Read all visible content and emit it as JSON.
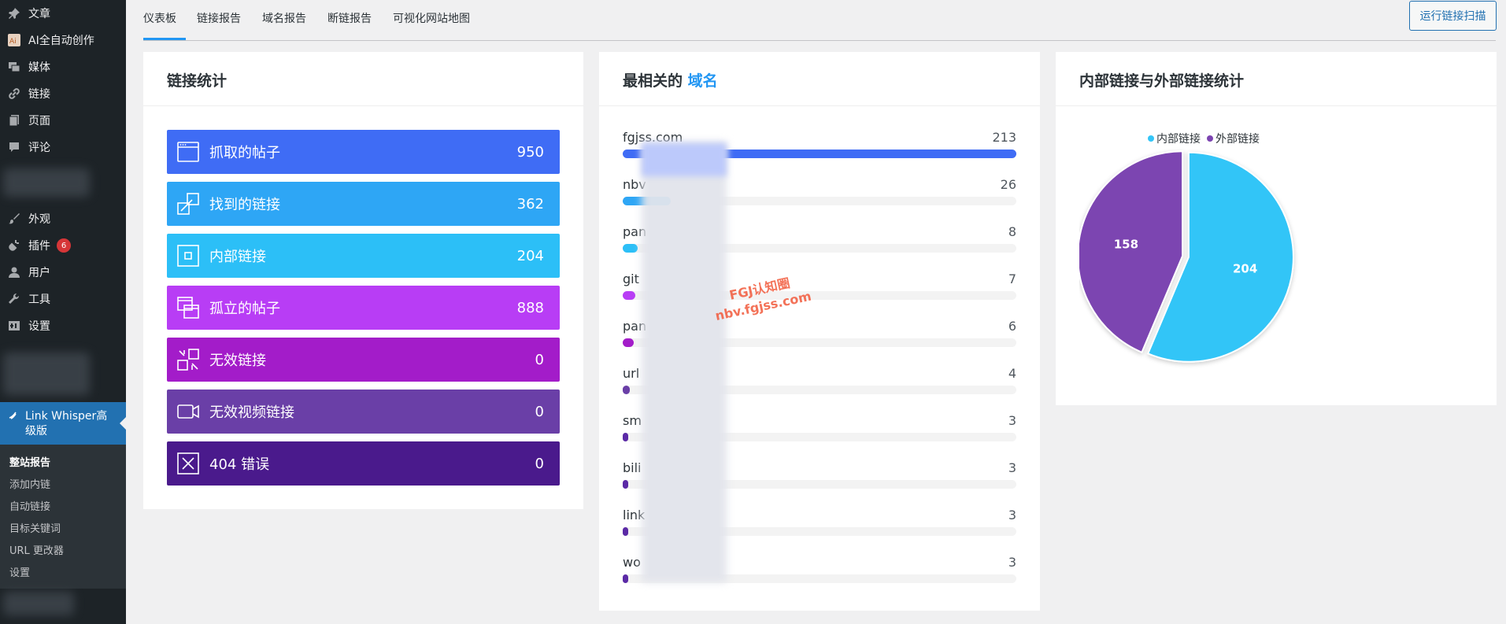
{
  "sidebar": {
    "items": [
      {
        "label": "文章",
        "icon": "pin-icon"
      },
      {
        "label": "AI全自动创作",
        "icon": "ai-icon"
      },
      {
        "label": "媒体",
        "icon": "media-icon"
      },
      {
        "label": "链接",
        "icon": "link-icon"
      },
      {
        "label": "页面",
        "icon": "page-icon"
      },
      {
        "label": "评论",
        "icon": "comment-icon"
      },
      {
        "label": "外观",
        "icon": "brush-icon"
      },
      {
        "label": "插件",
        "icon": "plugin-icon",
        "badge": "6"
      },
      {
        "label": "用户",
        "icon": "user-icon"
      },
      {
        "label": "工具",
        "icon": "wrench-icon"
      },
      {
        "label": "设置",
        "icon": "settings-icon"
      }
    ],
    "active_plugin": {
      "label": "Link Whisper高级版",
      "icon": "link-whisper-icon"
    },
    "submenu": [
      "整站报告",
      "添加内链",
      "自动链接",
      "目标关键词",
      "URL 更改器",
      "设置"
    ]
  },
  "tabs": [
    "仪表板",
    "链接报告",
    "域名报告",
    "断链报告",
    "可视化网站地图"
  ],
  "scan_button": "运行链接扫描",
  "link_stats": {
    "title": "链接统计",
    "items": [
      {
        "label": "抓取的帖子",
        "value": "950",
        "color": "#3f6cf5"
      },
      {
        "label": "找到的链接",
        "value": "362",
        "color": "#2ea6f5"
      },
      {
        "label": "内部链接",
        "value": "204",
        "color": "#2cbff7"
      },
      {
        "label": "孤立的帖子",
        "value": "888",
        "color": "#b83df5"
      },
      {
        "label": "无效链接",
        "value": "0",
        "color": "#a31cc9"
      },
      {
        "label": "无效视频链接",
        "value": "0",
        "color": "#6a3fa7"
      },
      {
        "label": "404 错误",
        "value": "0",
        "color": "#4a1a8c"
      }
    ]
  },
  "domains": {
    "title_prefix": "最相关的 ",
    "title_accent": "域名",
    "max": 213,
    "items": [
      {
        "name": "fgjss.com",
        "count": 213,
        "color": "#3f6cf5"
      },
      {
        "name": "nbv",
        "count": 26,
        "color": "#2ea6f5"
      },
      {
        "name": "pan",
        "count": 8,
        "color": "#2cbff7"
      },
      {
        "name": "git",
        "count": 7,
        "color": "#b83df5"
      },
      {
        "name": "pan",
        "count": 6,
        "color": "#a31cc9"
      },
      {
        "name": "url",
        "count": 4,
        "color": "#6a3fa7"
      },
      {
        "name": "sm",
        "count": 3,
        "color": "#5b2aa6"
      },
      {
        "name": "bili",
        "count": 3,
        "color": "#5b2aa6"
      },
      {
        "name": "link",
        "count": 3,
        "color": "#5b2aa6"
      },
      {
        "name": "wo",
        "count": 3,
        "color": "#5b2aa6"
      }
    ]
  },
  "watermark": {
    "line1": "FGJ认知圈",
    "line2": "nbv.fgjss.com"
  },
  "chart_data": {
    "type": "pie",
    "title": "内部链接与外部链接统计",
    "legend_position": "top",
    "slices": [
      {
        "label": "内部链接",
        "value": 204,
        "color": "#33c5f7"
      },
      {
        "label": "外部链接",
        "value": 158,
        "color": "#7c44b1"
      }
    ]
  }
}
